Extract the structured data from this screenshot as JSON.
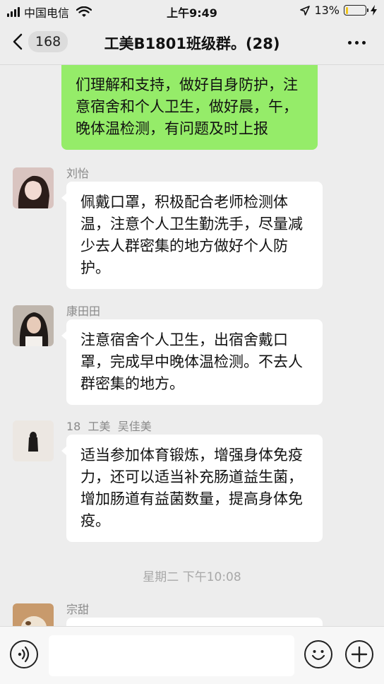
{
  "status_bar": {
    "carrier": "中国电信",
    "time": "上午9:49",
    "battery_percent": "13%",
    "battery_level": 0.13,
    "battery_color": "#f0c419"
  },
  "nav": {
    "unread_count": "168",
    "title": "工美B1801班级群。(28)",
    "back_icon": "chevron-left-icon",
    "more_icon": "more-dots-icon"
  },
  "chat": {
    "own_message": {
      "text": "们理解和支持，做好自身防护，注意宿舍和个人卫生，做好晨，午，晚体温检测，有问题及时上报",
      "bubble_color": "#95ec69"
    },
    "messages": [
      {
        "sender": "刘怡",
        "text": "佩戴口罩，积极配合老师检测体温，注意个人卫生勤洗手，尽量减少去人群密集的地方做好个人防护。"
      },
      {
        "sender": "康田田",
        "text": "注意宿舍个人卫生，出宿舍戴口罩，完成早中晚体温检测。不去人群密集的地方。"
      },
      {
        "sender": "18  工美  吴佳美",
        "text": "适当参加体育锻炼，增强身体免疫力，还可以适当补充肠道益生菌，增加肠道有益菌数量，提高身体免疫。"
      },
      {
        "sender": "宗甜",
        "text": ""
      }
    ],
    "time_divider": "星期二 下午10:08"
  },
  "input_bar": {
    "voice_icon": "voice-icon",
    "emoji_icon": "emoji-icon",
    "plus_icon": "plus-icon"
  }
}
